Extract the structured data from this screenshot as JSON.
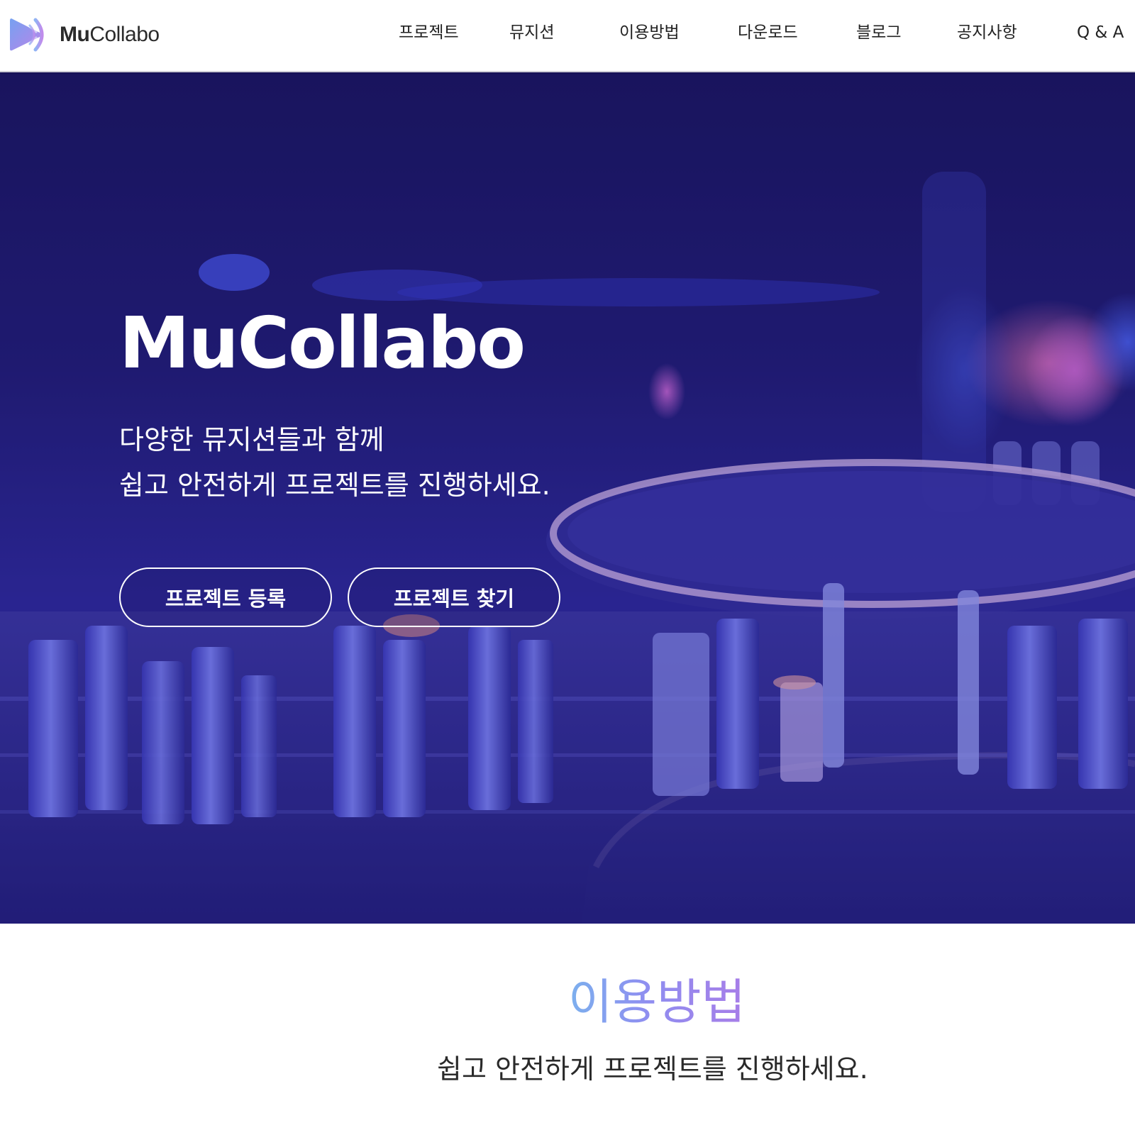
{
  "header": {
    "logo": {
      "icon": "play-triangle-logo-icon",
      "brand_bold": "Mu",
      "brand_light": "Collabo"
    },
    "nav": [
      {
        "id": "project",
        "label": "프로젝트"
      },
      {
        "id": "musician",
        "label": "뮤지션"
      },
      {
        "id": "howto",
        "label": "이용방법"
      },
      {
        "id": "download",
        "label": "다운로드"
      },
      {
        "id": "blog",
        "label": "블로그"
      },
      {
        "id": "notice",
        "label": "공지사항"
      },
      {
        "id": "qna",
        "label": "Q & A"
      }
    ]
  },
  "hero": {
    "title": "MuCollabo",
    "subtitle_line1": "다양한 뮤지션들과 함께",
    "subtitle_line2": "쉽고 안전하게 프로젝트를 진행하세요.",
    "buttons": {
      "register": "프로젝트 등록",
      "find": "프로젝트 찾기"
    },
    "background": "dj-mixer-console-photo"
  },
  "intro": {
    "title": "이용방법",
    "subtitle": "쉽고 안전하게 프로젝트를 진행하세요."
  },
  "colors": {
    "hero_overlay": "#2b2490",
    "accent_gradient_start": "#7cb0ee",
    "accent_gradient_end": "#a77de8",
    "logo_gradient_start": "#6f9cf0",
    "logo_gradient_end": "#b57ee8",
    "nav_text": "#222222",
    "header_border": "#cfcfd6"
  }
}
